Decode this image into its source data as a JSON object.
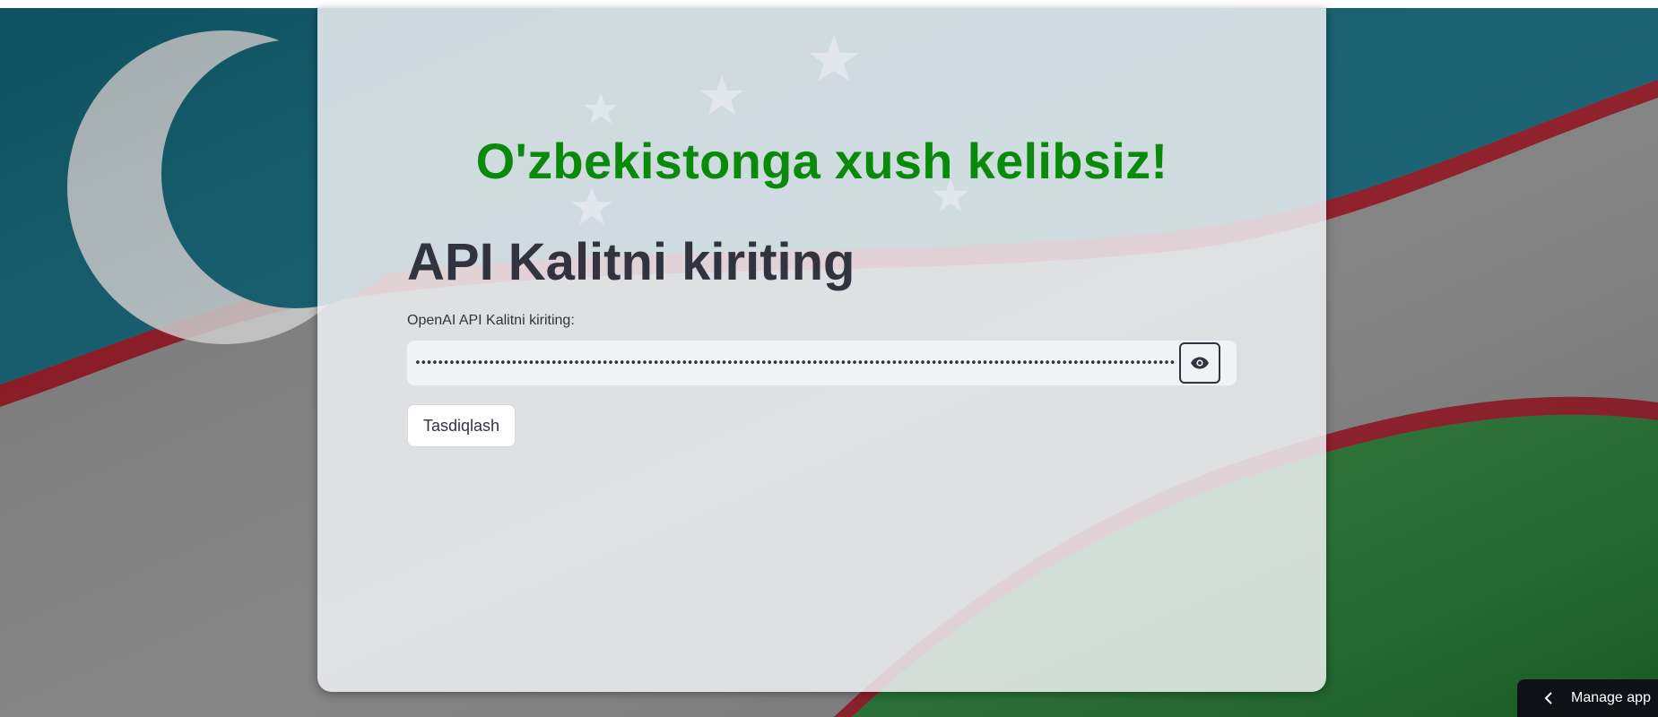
{
  "welcome": {
    "title": "O'zbekistonga xush kelibsiz!"
  },
  "api_section": {
    "heading": "API Kalitni kiriting",
    "field_label": "OpenAI API Kalitni kiriting:",
    "masked_value": "••••••••••••••••••••••••••••••••••••••••••••••••••••••••••••••••••••••••••••••••••••••••••••••••••••••••••••••••••••••••••••••••••••••••••••••••••••••••••••••••••••••••••••••••••••••",
    "toggle_icon": "eye-icon",
    "confirm_label": "Tasdiqlash"
  },
  "manage_app": {
    "label": "Manage app",
    "icon": "chevron-left-icon"
  },
  "colors": {
    "title_green": "#0a8a0a",
    "text_dark": "#31333f",
    "input_bg": "#f0f2f6",
    "flag_blue": "#0f5a6b",
    "flag_red": "#b3121f",
    "flag_green": "#1f7a31",
    "manage_bg": "#0e1117"
  }
}
